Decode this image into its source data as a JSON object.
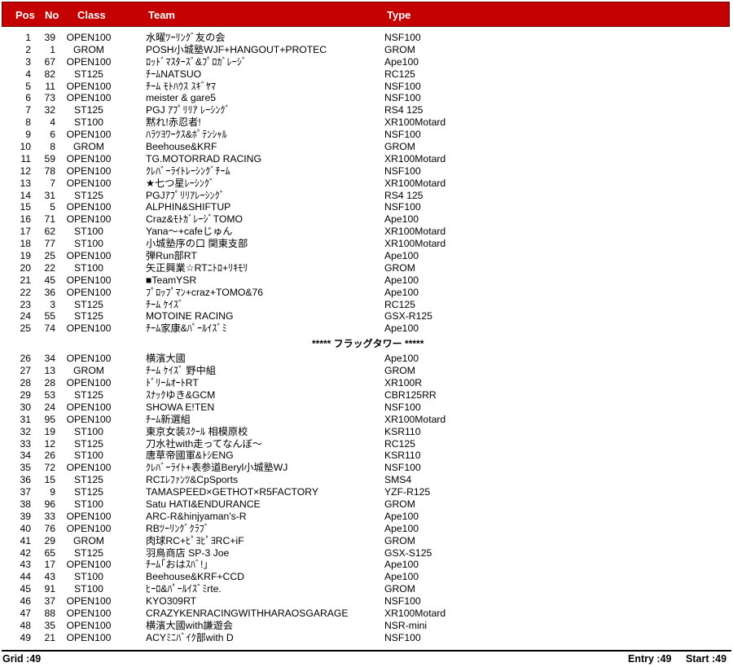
{
  "headers": {
    "pos": "Pos",
    "no": "No",
    "class": "Class",
    "team": "Team",
    "type": "Type"
  },
  "rows_before": [
    {
      "pos": "1",
      "no": "39",
      "cls": "OPEN100",
      "team": "水曜ﾂｰﾘﾝｸﾞ友の会",
      "type": "NSF100"
    },
    {
      "pos": "2",
      "no": "1",
      "cls": "GROM",
      "team": "POSH小城塾WJF+HANGOUT+PROTEC",
      "type": "GROM"
    },
    {
      "pos": "3",
      "no": "67",
      "cls": "OPEN100",
      "team": "ﾛｯﾄﾞﾏｽﾀｰｽﾞ&ﾌﾟﾛｶﾞﾚｰｼﾞ",
      "type": "Ape100"
    },
    {
      "pos": "4",
      "no": "82",
      "cls": "ST125",
      "team": "ﾁｰﾑNATSUO",
      "type": "RC125"
    },
    {
      "pos": "5",
      "no": "11",
      "cls": "OPEN100",
      "team": "ﾁｰﾑ ﾓﾄﾊｳｽ ｽｷﾞﾔﾏ",
      "type": "NSF100"
    },
    {
      "pos": "6",
      "no": "73",
      "cls": "OPEN100",
      "team": "meister & gare5",
      "type": "NSF100"
    },
    {
      "pos": "7",
      "no": "32",
      "cls": "ST125",
      "team": "PGJ ｱﾌﾟﾘﾘｱ ﾚｰｼﾝｸﾞ",
      "type": "RS4 125"
    },
    {
      "pos": "8",
      "no": "4",
      "cls": "ST100",
      "team": "黙れ!赤忍者!",
      "type": "XR100Motard"
    },
    {
      "pos": "9",
      "no": "6",
      "cls": "OPEN100",
      "team": "ﾊﾗﾂﾖﾜｰｸｽ&ﾎﾟﾃﾝｼｬﾙ",
      "type": "NSF100"
    },
    {
      "pos": "10",
      "no": "8",
      "cls": "GROM",
      "team": "Beehouse&KRF",
      "type": "GROM"
    },
    {
      "pos": "11",
      "no": "59",
      "cls": "OPEN100",
      "team": "TG.MOTORRAD RACING",
      "type": "XR100Motard"
    },
    {
      "pos": "12",
      "no": "78",
      "cls": "OPEN100",
      "team": "ｸﾚﾊﾞｰﾗｲﾄﾚｰｼﾝｸﾞﾁｰﾑ",
      "type": "NSF100"
    },
    {
      "pos": "13",
      "no": "7",
      "cls": "OPEN100",
      "team": "★七つ星ﾚｰｼﾝｸﾞ",
      "type": "XR100Motard"
    },
    {
      "pos": "14",
      "no": "31",
      "cls": "ST125",
      "team": "PGJｱﾌﾟﾘﾘｱﾚｰｼﾝｸﾞ",
      "type": "RS4 125"
    },
    {
      "pos": "15",
      "no": "5",
      "cls": "OPEN100",
      "team": "ALPHIN&SHIFTUP",
      "type": "NSF100"
    },
    {
      "pos": "16",
      "no": "71",
      "cls": "OPEN100",
      "team": "Craz&ﾓﾄｶﾞﾚｰｼﾞTOMO",
      "type": "Ape100"
    },
    {
      "pos": "17",
      "no": "62",
      "cls": "ST100",
      "team": "Yana～+cafeじゅん",
      "type": "XR100Motard"
    },
    {
      "pos": "18",
      "no": "77",
      "cls": "ST100",
      "team": "小城塾序の口 関東支部",
      "type": "XR100Motard"
    },
    {
      "pos": "19",
      "no": "25",
      "cls": "OPEN100",
      "team": "弾Run部RT",
      "type": "Ape100"
    },
    {
      "pos": "20",
      "no": "22",
      "cls": "ST100",
      "team": "矢正興業☆RTﾆﾄﾛ+ﾘｷﾓﾘ",
      "type": "GROM"
    },
    {
      "pos": "21",
      "no": "45",
      "cls": "OPEN100",
      "team": "■TeamYSR",
      "type": "Ape100"
    },
    {
      "pos": "22",
      "no": "36",
      "cls": "OPEN100",
      "team": "ﾌﾟﾛｯﾌﾟﾏﾝ+craz+TOMO&76",
      "type": "Ape100"
    },
    {
      "pos": "23",
      "no": "3",
      "cls": "ST125",
      "team": "ﾁｰﾑ ｹｲｽﾞ",
      "type": "RC125"
    },
    {
      "pos": "24",
      "no": "55",
      "cls": "ST125",
      "team": "MOTOINE RACING",
      "type": "GSX-R125"
    },
    {
      "pos": "25",
      "no": "74",
      "cls": "OPEN100",
      "team": "ﾁｰﾑ家康&ﾊﾟｰﾙｲｽﾞﾐ",
      "type": "Ape100"
    }
  ],
  "separator": "***** フラッグタワー *****",
  "rows_after": [
    {
      "pos": "26",
      "no": "34",
      "cls": "OPEN100",
      "team": "横濱大國",
      "type": "Ape100"
    },
    {
      "pos": "27",
      "no": "13",
      "cls": "GROM",
      "team": "ﾁｰﾑ ｹｲｽﾞ 野中組",
      "type": "GROM"
    },
    {
      "pos": "28",
      "no": "28",
      "cls": "OPEN100",
      "team": "ﾄﾞﾘｰﾑｵｰﾄRT",
      "type": "XR100R"
    },
    {
      "pos": "29",
      "no": "53",
      "cls": "ST125",
      "team": "ｽﾅｯｸゆき&GCM",
      "type": "CBR125RR"
    },
    {
      "pos": "30",
      "no": "24",
      "cls": "OPEN100",
      "team": "SHOWA E!TEN",
      "type": "NSF100"
    },
    {
      "pos": "31",
      "no": "95",
      "cls": "OPEN100",
      "team": "ﾁｰﾑ新選組",
      "type": "XR100Motard"
    },
    {
      "pos": "32",
      "no": "19",
      "cls": "ST100",
      "team": "東京女装ｽｸｰﾙ 相模原校",
      "type": "KSR110"
    },
    {
      "pos": "33",
      "no": "12",
      "cls": "ST125",
      "team": "刀水社with走ってなんぼ～",
      "type": "RC125"
    },
    {
      "pos": "34",
      "no": "26",
      "cls": "ST100",
      "team": "唐草帝國軍&ﾄｼENG",
      "type": "KSR110"
    },
    {
      "pos": "35",
      "no": "72",
      "cls": "OPEN100",
      "team": "ｸﾚﾊﾞｰﾗｲﾄ+表参道Beryl小城塾WJ",
      "type": "NSF100"
    },
    {
      "pos": "36",
      "no": "15",
      "cls": "ST125",
      "team": "RCｴﾚﾌｧﾝﾂ&CpSports",
      "type": "SMS4"
    },
    {
      "pos": "37",
      "no": "9",
      "cls": "ST125",
      "team": "TAMASPEED×GETHOT×R5FACTORY",
      "type": "YZF-R125"
    },
    {
      "pos": "38",
      "no": "96",
      "cls": "ST100",
      "team": "Satu HATI&ENDURANCE",
      "type": "GROM"
    },
    {
      "pos": "39",
      "no": "33",
      "cls": "OPEN100",
      "team": "ARC-R&hinjyaman's-R",
      "type": "Ape100"
    },
    {
      "pos": "40",
      "no": "76",
      "cls": "OPEN100",
      "team": "RBﾂｰﾘﾝｸﾞｸﾗﾌﾞ",
      "type": "Ape100"
    },
    {
      "pos": "41",
      "no": "29",
      "cls": "GROM",
      "team": "肉球RC+ﾋﾟﾖﾋﾟﾖRC+iF",
      "type": "GROM"
    },
    {
      "pos": "42",
      "no": "65",
      "cls": "ST125",
      "team": "羽鳥商店 SP-3 Joe",
      "type": "GSX-S125"
    },
    {
      "pos": "43",
      "no": "17",
      "cls": "OPEN100",
      "team": "ﾁｰﾑ｢おはｽﾊﾞ!｣",
      "type": "Ape100"
    },
    {
      "pos": "44",
      "no": "43",
      "cls": "ST100",
      "team": "Beehouse&KRF+CCD",
      "type": "Ape100"
    },
    {
      "pos": "45",
      "no": "91",
      "cls": "ST100",
      "team": "ﾋｰﾛ&ﾊﾟｰﾙｲｽﾞﾐrte.",
      "type": "GROM"
    },
    {
      "pos": "46",
      "no": "37",
      "cls": "OPEN100",
      "team": "KYO309RT",
      "type": "NSF100"
    },
    {
      "pos": "47",
      "no": "88",
      "cls": "OPEN100",
      "team": "CRAZYKENRACINGWITHHARAOSGARAGE",
      "type": "XR100Motard"
    },
    {
      "pos": "48",
      "no": "35",
      "cls": "OPEN100",
      "team": "横濱大國with謙遊会",
      "type": "NSR-mini"
    },
    {
      "pos": "49",
      "no": "21",
      "cls": "OPEN100",
      "team": "ACYﾐﾆﾊﾞｲｸ部with D",
      "type": "NSF100"
    }
  ],
  "footer": {
    "grid": "Grid :49",
    "entry": "Entry :49",
    "start": "Start :49"
  }
}
